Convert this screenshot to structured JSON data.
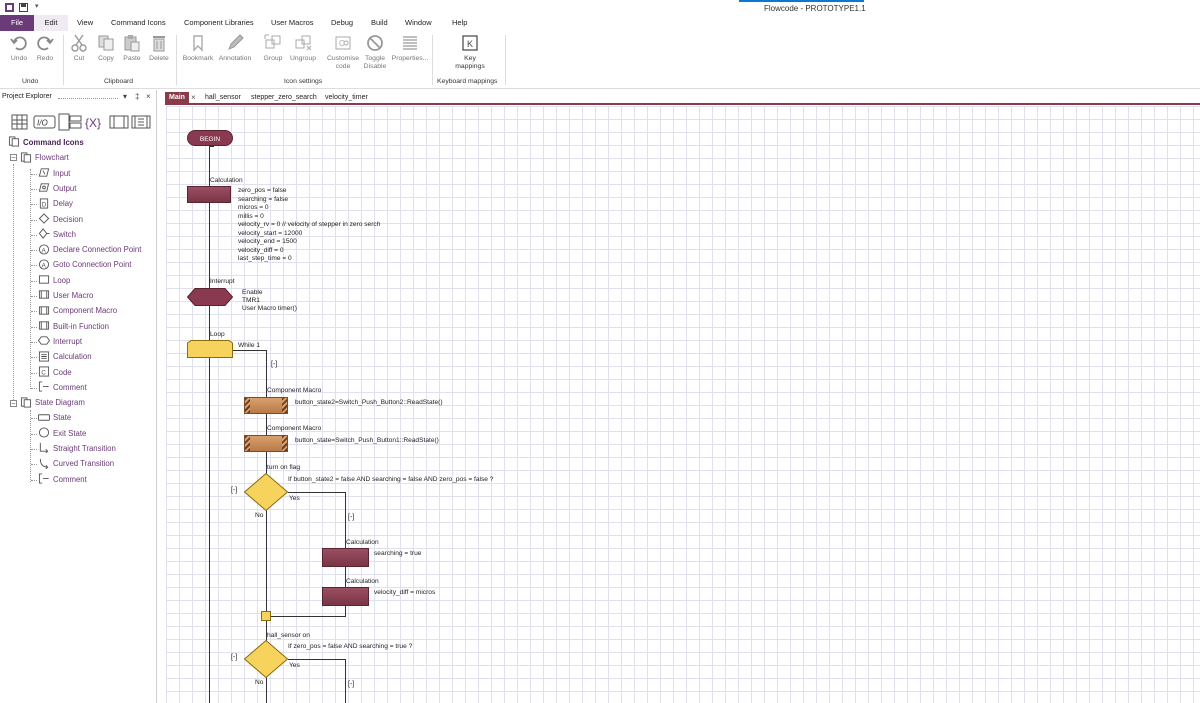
{
  "window": {
    "title": "Flowcode - PROTOTYPE1.1"
  },
  "menu": {
    "items": [
      "File",
      "Edit",
      "View",
      "Command Icons",
      "Component Libraries",
      "User Macros",
      "Debug",
      "Build",
      "Window",
      "Help"
    ]
  },
  "ribbon": {
    "undo": "Undo",
    "redo": "Redo",
    "group_undo": "Undo",
    "cut": "Cut",
    "copy": "Copy",
    "paste": "Paste",
    "delete": "Delete",
    "group_clipboard": "Clipboard",
    "bookmark": "Bookmark",
    "annotation": "Annotation",
    "group": "Group",
    "ungroup": "Ungroup",
    "customise_l1": "Customise",
    "customise_l2": "code",
    "toggle_l1": "Toggle",
    "toggle_l2": "Disable",
    "properties": "Properties...",
    "group_icon_settings": "Icon settings",
    "key_l1": "Key",
    "key_l2": "mappings",
    "group_keyboard": "Keyboard mappings"
  },
  "explorer": {
    "title": "Project Explorer",
    "toolstrip_io": "I/O",
    "toolstrip_var": "{X}",
    "tree": [
      {
        "label": "Command Icons",
        "icon": "command-icons-icon"
      },
      {
        "label": "Flowchart",
        "icon": "flowchart-icon"
      },
      {
        "label": "Input",
        "icon": "input-icon"
      },
      {
        "label": "Output",
        "icon": "output-icon"
      },
      {
        "label": "Delay",
        "icon": "delay-icon"
      },
      {
        "label": "Decision",
        "icon": "decision-icon"
      },
      {
        "label": "Switch",
        "icon": "switch-icon"
      },
      {
        "label": "Declare Connection Point",
        "icon": "declare-connection-icon"
      },
      {
        "label": "Goto Connection Point",
        "icon": "goto-connection-icon"
      },
      {
        "label": "Loop",
        "icon": "loop-icon"
      },
      {
        "label": "User Macro",
        "icon": "user-macro-icon"
      },
      {
        "label": "Component Macro",
        "icon": "component-macro-icon"
      },
      {
        "label": "Built-in Function",
        "icon": "builtin-function-icon"
      },
      {
        "label": "Interrupt",
        "icon": "interrupt-icon"
      },
      {
        "label": "Calculation",
        "icon": "calculation-icon"
      },
      {
        "label": "Code",
        "icon": "code-icon"
      },
      {
        "label": "Comment",
        "icon": "comment-icon"
      },
      {
        "label": "State Diagram",
        "icon": "state-diagram-icon"
      },
      {
        "label": "State",
        "icon": "state-icon"
      },
      {
        "label": "Exit State",
        "icon": "exit-state-icon"
      },
      {
        "label": "Straight Transition",
        "icon": "straight-transition-icon"
      },
      {
        "label": "Curved Transition",
        "icon": "curved-transition-icon"
      },
      {
        "label": "Comment",
        "icon": "comment-icon"
      }
    ]
  },
  "tabs": [
    "Main",
    "hall_sensor",
    "stepper_zero_search",
    "velocity_timer"
  ],
  "flowchart": {
    "begin": "BEGIN",
    "calc1": {
      "title": "Calculation",
      "lines": [
        "zero_pos = false",
        "searching = false",
        "micros = 0",
        "millis = 0",
        "velocity_rv = 0 // velocity of stepper in zero serch",
        "velocity_start = 12000",
        "velocity_end = 1500",
        "velocity_diff = 0",
        "last_step_time = 0"
      ]
    },
    "interrupt": {
      "title": "Interrupt",
      "lines": [
        "Enable",
        "TMR1",
        "User Macro timer()"
      ]
    },
    "loop": {
      "title": "Loop",
      "cond": "While 1"
    },
    "collapse": "[-]",
    "comp1": {
      "title": "Component Macro",
      "text": "button_state2=Switch_Push_Button2::ReadState()"
    },
    "comp2": {
      "title": "Component Macro",
      "text": "button_state=Switch_Push_Button1::ReadState()"
    },
    "dec1": {
      "title": "turn on flag",
      "cond": "If  button_state2 = false AND searching = false AND zero_pos = false ?",
      "yes": "Yes",
      "no": "No"
    },
    "calc2": {
      "title": "Calculation",
      "text": "searching = true"
    },
    "calc3": {
      "title": "Calculation",
      "text": "velocity_diff = micros"
    },
    "dec2": {
      "title": "hall_sensor on",
      "cond": "If  zero_pos = false AND searching = true ?",
      "yes": "Yes",
      "no": "No"
    }
  }
}
